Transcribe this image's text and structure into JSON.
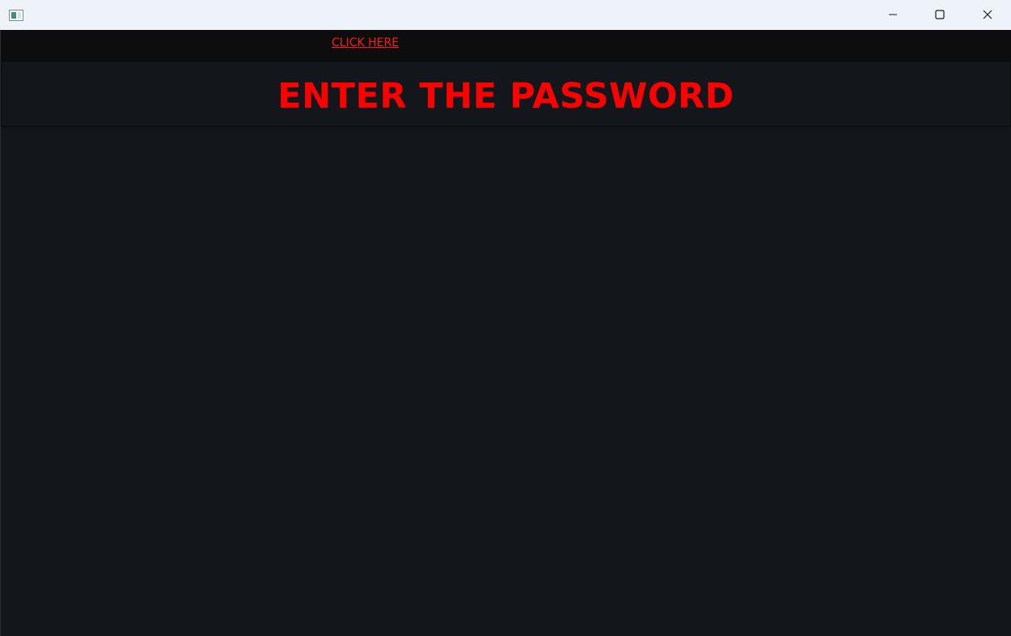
{
  "window": {
    "title_icon": "app-window-icon",
    "controls": {
      "minimize": "minimize-icon",
      "maximize": "maximize-icon",
      "close": "close-icon"
    }
  },
  "navbar": {
    "link_label": "CLICK HERE"
  },
  "header": {
    "title": "ENTER THE PASSWORD"
  },
  "colors": {
    "accent": "#ff0000",
    "background": "#13171b",
    "navbar": "#0d0d0d",
    "titlebar": "#eef3fa"
  }
}
